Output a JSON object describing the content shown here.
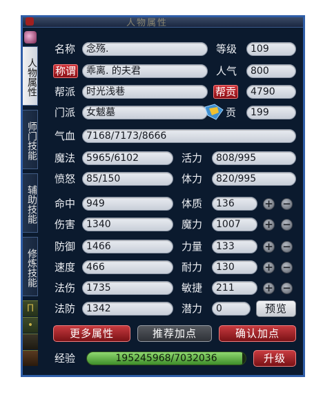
{
  "window": {
    "title": "人物属性"
  },
  "sidetabs": [
    "人物属性",
    "师门技能",
    "辅助技能",
    "修炼技能"
  ],
  "rows": {
    "name": {
      "label": "名称",
      "value": "念殇."
    },
    "level": {
      "label": "等级",
      "value": "109"
    },
    "title": {
      "label": "称谓",
      "value": "乖离. 的夫君"
    },
    "popularity": {
      "label": "人气",
      "value": "800"
    },
    "faction": {
      "label": "帮派",
      "value": "时光浅巷"
    },
    "contrib": {
      "label": "帮贡",
      "value": "4790"
    },
    "school": {
      "label": "门派",
      "value": "女魃墓"
    },
    "school_contrib": {
      "label": "贡",
      "value": "199"
    },
    "qixue": {
      "label": "气血",
      "value": "7168/7173/8666"
    },
    "mofa": {
      "label": "魔法",
      "value": "5965/6102"
    },
    "huoli": {
      "label": "活力",
      "value": "808/995"
    },
    "fennu": {
      "label": "愤怒",
      "value": "85/150"
    },
    "tili": {
      "label": "体力",
      "value": "820/995"
    }
  },
  "stats_left": [
    {
      "label": "命中",
      "value": "949"
    },
    {
      "label": "伤害",
      "value": "1340"
    },
    {
      "label": "防御",
      "value": "1466"
    },
    {
      "label": "速度",
      "value": "466"
    },
    {
      "label": "法伤",
      "value": "1735"
    },
    {
      "label": "法防",
      "value": "1342"
    }
  ],
  "stats_right": [
    {
      "label": "体质",
      "value": "136"
    },
    {
      "label": "魔力",
      "value": "1007"
    },
    {
      "label": "力量",
      "value": "133"
    },
    {
      "label": "耐力",
      "value": "130"
    },
    {
      "label": "敏捷",
      "value": "211"
    },
    {
      "label": "潜力",
      "value": "0"
    }
  ],
  "controls": {
    "plus": "+",
    "minus": "−",
    "preview": "预览"
  },
  "buttons": {
    "more_attrs": "更多属性",
    "recommend": "推荐加点",
    "confirm": "确认加点",
    "upgrade": "升级"
  },
  "exp": {
    "label": "经验",
    "value": "195245968/7032036",
    "fill_ratio": 0.98
  },
  "colors": {
    "accent_red": "#c73a3f",
    "exp_green": "#5fb540",
    "frame_blue": "#2f5ea8"
  }
}
